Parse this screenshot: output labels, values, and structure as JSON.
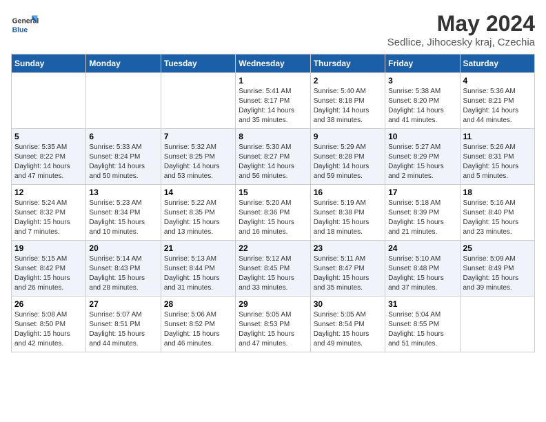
{
  "header": {
    "logo_general": "General",
    "logo_blue": "Blue",
    "month_title": "May 2024",
    "location": "Sedlice, Jihocesky kraj, Czechia"
  },
  "days_of_week": [
    "Sunday",
    "Monday",
    "Tuesday",
    "Wednesday",
    "Thursday",
    "Friday",
    "Saturday"
  ],
  "weeks": [
    [
      {
        "day": "",
        "info": ""
      },
      {
        "day": "",
        "info": ""
      },
      {
        "day": "",
        "info": ""
      },
      {
        "day": "1",
        "info": "Sunrise: 5:41 AM\nSunset: 8:17 PM\nDaylight: 14 hours and 35 minutes."
      },
      {
        "day": "2",
        "info": "Sunrise: 5:40 AM\nSunset: 8:18 PM\nDaylight: 14 hours and 38 minutes."
      },
      {
        "day": "3",
        "info": "Sunrise: 5:38 AM\nSunset: 8:20 PM\nDaylight: 14 hours and 41 minutes."
      },
      {
        "day": "4",
        "info": "Sunrise: 5:36 AM\nSunset: 8:21 PM\nDaylight: 14 hours and 44 minutes."
      }
    ],
    [
      {
        "day": "5",
        "info": "Sunrise: 5:35 AM\nSunset: 8:22 PM\nDaylight: 14 hours and 47 minutes."
      },
      {
        "day": "6",
        "info": "Sunrise: 5:33 AM\nSunset: 8:24 PM\nDaylight: 14 hours and 50 minutes."
      },
      {
        "day": "7",
        "info": "Sunrise: 5:32 AM\nSunset: 8:25 PM\nDaylight: 14 hours and 53 minutes."
      },
      {
        "day": "8",
        "info": "Sunrise: 5:30 AM\nSunset: 8:27 PM\nDaylight: 14 hours and 56 minutes."
      },
      {
        "day": "9",
        "info": "Sunrise: 5:29 AM\nSunset: 8:28 PM\nDaylight: 14 hours and 59 minutes."
      },
      {
        "day": "10",
        "info": "Sunrise: 5:27 AM\nSunset: 8:29 PM\nDaylight: 15 hours and 2 minutes."
      },
      {
        "day": "11",
        "info": "Sunrise: 5:26 AM\nSunset: 8:31 PM\nDaylight: 15 hours and 5 minutes."
      }
    ],
    [
      {
        "day": "12",
        "info": "Sunrise: 5:24 AM\nSunset: 8:32 PM\nDaylight: 15 hours and 7 minutes."
      },
      {
        "day": "13",
        "info": "Sunrise: 5:23 AM\nSunset: 8:34 PM\nDaylight: 15 hours and 10 minutes."
      },
      {
        "day": "14",
        "info": "Sunrise: 5:22 AM\nSunset: 8:35 PM\nDaylight: 15 hours and 13 minutes."
      },
      {
        "day": "15",
        "info": "Sunrise: 5:20 AM\nSunset: 8:36 PM\nDaylight: 15 hours and 16 minutes."
      },
      {
        "day": "16",
        "info": "Sunrise: 5:19 AM\nSunset: 8:38 PM\nDaylight: 15 hours and 18 minutes."
      },
      {
        "day": "17",
        "info": "Sunrise: 5:18 AM\nSunset: 8:39 PM\nDaylight: 15 hours and 21 minutes."
      },
      {
        "day": "18",
        "info": "Sunrise: 5:16 AM\nSunset: 8:40 PM\nDaylight: 15 hours and 23 minutes."
      }
    ],
    [
      {
        "day": "19",
        "info": "Sunrise: 5:15 AM\nSunset: 8:42 PM\nDaylight: 15 hours and 26 minutes."
      },
      {
        "day": "20",
        "info": "Sunrise: 5:14 AM\nSunset: 8:43 PM\nDaylight: 15 hours and 28 minutes."
      },
      {
        "day": "21",
        "info": "Sunrise: 5:13 AM\nSunset: 8:44 PM\nDaylight: 15 hours and 31 minutes."
      },
      {
        "day": "22",
        "info": "Sunrise: 5:12 AM\nSunset: 8:45 PM\nDaylight: 15 hours and 33 minutes."
      },
      {
        "day": "23",
        "info": "Sunrise: 5:11 AM\nSunset: 8:47 PM\nDaylight: 15 hours and 35 minutes."
      },
      {
        "day": "24",
        "info": "Sunrise: 5:10 AM\nSunset: 8:48 PM\nDaylight: 15 hours and 37 minutes."
      },
      {
        "day": "25",
        "info": "Sunrise: 5:09 AM\nSunset: 8:49 PM\nDaylight: 15 hours and 39 minutes."
      }
    ],
    [
      {
        "day": "26",
        "info": "Sunrise: 5:08 AM\nSunset: 8:50 PM\nDaylight: 15 hours and 42 minutes."
      },
      {
        "day": "27",
        "info": "Sunrise: 5:07 AM\nSunset: 8:51 PM\nDaylight: 15 hours and 44 minutes."
      },
      {
        "day": "28",
        "info": "Sunrise: 5:06 AM\nSunset: 8:52 PM\nDaylight: 15 hours and 46 minutes."
      },
      {
        "day": "29",
        "info": "Sunrise: 5:05 AM\nSunset: 8:53 PM\nDaylight: 15 hours and 47 minutes."
      },
      {
        "day": "30",
        "info": "Sunrise: 5:05 AM\nSunset: 8:54 PM\nDaylight: 15 hours and 49 minutes."
      },
      {
        "day": "31",
        "info": "Sunrise: 5:04 AM\nSunset: 8:55 PM\nDaylight: 15 hours and 51 minutes."
      },
      {
        "day": "",
        "info": ""
      }
    ]
  ]
}
